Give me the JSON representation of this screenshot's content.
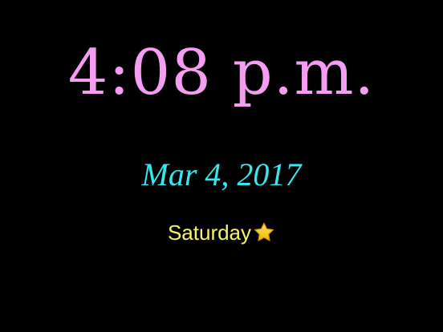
{
  "clock": {
    "time": "4:08 p.m.",
    "date": "Mar 4, 2017",
    "weekday": "Saturday",
    "weekday_icon": "star-icon"
  },
  "colors": {
    "background": "#000000",
    "time": "#f59cf3",
    "date": "#36e7ee",
    "weekday": "#f6f36a",
    "star": "#f6b400"
  }
}
